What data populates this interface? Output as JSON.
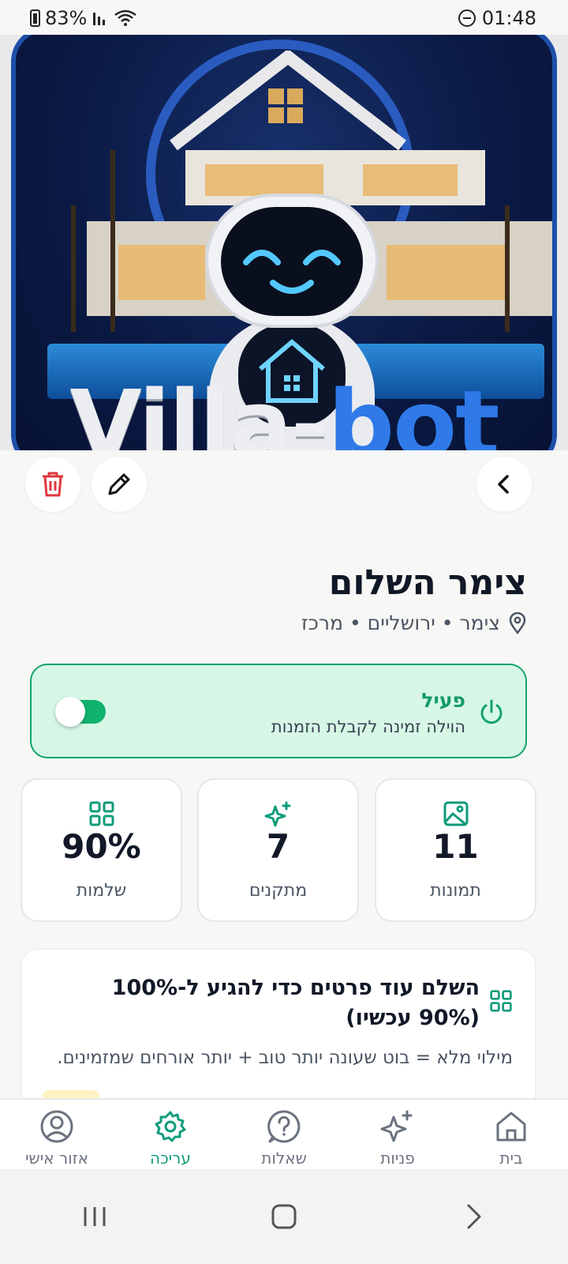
{
  "status_bar": {
    "battery": "83%",
    "time": "01:48"
  },
  "hero": {
    "brand_part1": "Villa-",
    "brand_part2": "bot"
  },
  "listing": {
    "title": "צימר השלום",
    "location": "צימר • ירושליים • מרכז"
  },
  "availability": {
    "status": "פעיל",
    "description": "הוילה זמינה לקבלת הזמנות",
    "enabled": true
  },
  "stats": [
    {
      "icon": "image-icon",
      "value": "11",
      "label": "תמונות"
    },
    {
      "icon": "sparkle-icon",
      "value": "7",
      "label": "מתקנים"
    },
    {
      "icon": "grid-icon",
      "value": "90%",
      "label": "שלמות"
    }
  ],
  "completion": {
    "title": "השלם עוד פרטים כדי להגיע ל-100% (90% עכשיו)",
    "description": "מילוי מלא = בוט שעונה יותר טוב + יותר אורחים שמזמינים."
  },
  "bottom_nav": [
    {
      "icon": "home-icon",
      "label": "בית",
      "active": false
    },
    {
      "icon": "sparkle-icon",
      "label": "פניות",
      "active": false
    },
    {
      "icon": "question-icon",
      "label": "שאלות",
      "active": false
    },
    {
      "icon": "gear-icon",
      "label": "עריכה",
      "active": true
    },
    {
      "icon": "user-icon",
      "label": "אזור אישי",
      "active": false
    }
  ],
  "colors": {
    "accent": "#0f9b7a",
    "active_green": "#14a36a",
    "delete_red": "#e0383e"
  }
}
